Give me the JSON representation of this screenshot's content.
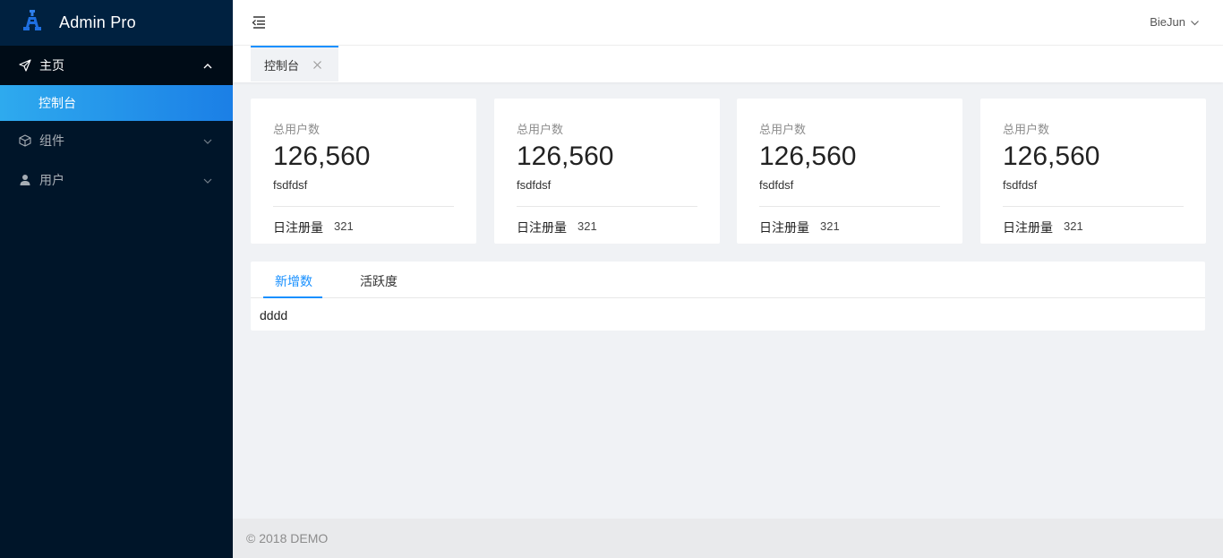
{
  "brand": {
    "title": "Admin Pro",
    "logo_icon": "admin-logo-icon",
    "accent": "#1890ff"
  },
  "sidebar": {
    "groups": [
      {
        "label": "主页",
        "icon": "send-icon",
        "expanded": true,
        "children": [
          {
            "label": "控制台",
            "active": true
          }
        ]
      },
      {
        "label": "组件",
        "icon": "cube-icon",
        "expanded": false
      },
      {
        "label": "用户",
        "icon": "user-icon",
        "expanded": false
      }
    ]
  },
  "header": {
    "user_name": "BieJun"
  },
  "tabs": [
    {
      "label": "控制台",
      "active": true
    }
  ],
  "cards": [
    {
      "title": "总用户数",
      "value": "126,560",
      "subtitle": "fsdfdsf",
      "footer_label": "日注册量",
      "footer_value": "321"
    },
    {
      "title": "总用户数",
      "value": "126,560",
      "subtitle": "fsdfdsf",
      "footer_label": "日注册量",
      "footer_value": "321"
    },
    {
      "title": "总用户数",
      "value": "126,560",
      "subtitle": "fsdfdsf",
      "footer_label": "日注册量",
      "footer_value": "321"
    },
    {
      "title": "总用户数",
      "value": "126,560",
      "subtitle": "fsdfdsf",
      "footer_label": "日注册量",
      "footer_value": "321"
    }
  ],
  "panel": {
    "tabs": [
      {
        "label": "新增数",
        "active": true
      },
      {
        "label": "活跃度",
        "active": false
      }
    ],
    "content": "dddd"
  },
  "footer": {
    "text": "© 2018 DEMO"
  }
}
